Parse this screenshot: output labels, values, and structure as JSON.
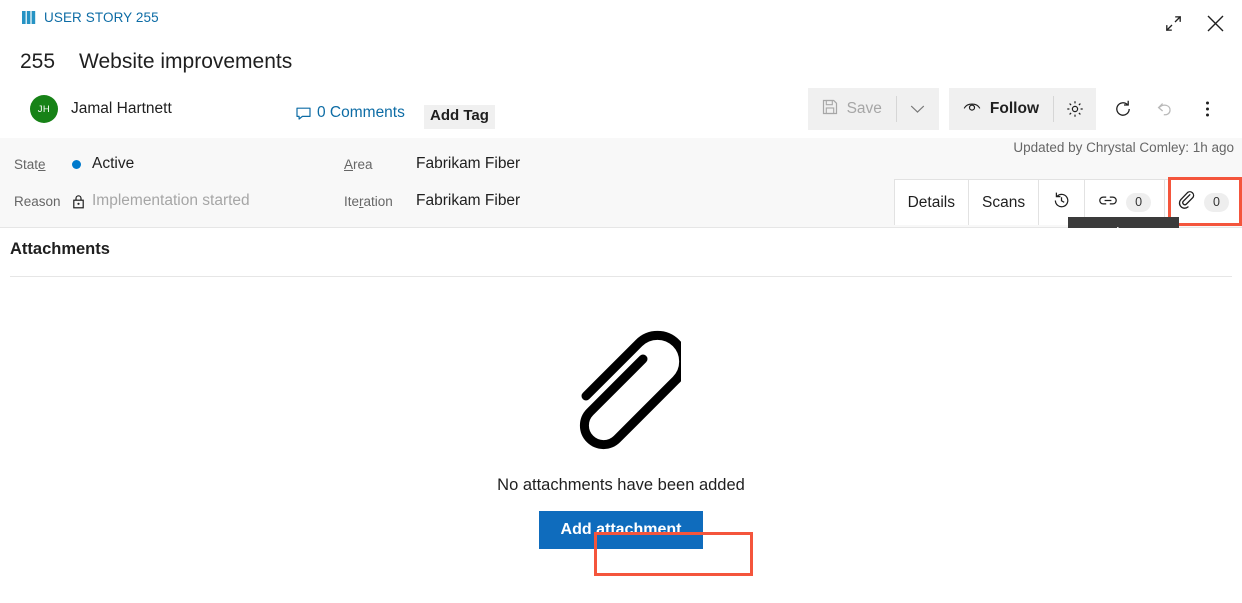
{
  "window": {
    "restore_icon": "restore-down-icon",
    "close_icon": "close-icon"
  },
  "header": {
    "work_item_type": "USER STORY 255",
    "work_item_type_icon": "user-story-icon",
    "id": "255",
    "title": "Website improvements",
    "assignee": {
      "initials": "JH",
      "name": "Jamal Hartnett",
      "avatar_color": "#178217"
    },
    "comments_label": "0 Comments",
    "comments_icon": "comment-icon",
    "add_tag_label": "Add Tag"
  },
  "toolbar": {
    "save_label": "Save",
    "save_icon": "save-disk-icon",
    "save_enabled": false,
    "save_caret_icon": "chevron-down-icon",
    "follow_label": "Follow",
    "follow_icon": "eye-icon",
    "settings_icon": "gear-icon",
    "refresh_icon": "refresh-icon",
    "undo_icon": "undo-icon",
    "more_icon": "more-vertical-icon"
  },
  "fields": {
    "state": {
      "label": "State",
      "label_accesskey": "e",
      "value": "Active",
      "dot_color": "#007acc",
      "icon": "state-dot-icon"
    },
    "reason": {
      "label": "Reason",
      "value": "Implementation started",
      "readonly": true,
      "icon": "lock-icon"
    },
    "area": {
      "label": "Area",
      "label_accesskey": "A",
      "value": "Fabrikam Fiber"
    },
    "iteration": {
      "label": "Iteration",
      "label_accesskey": "r",
      "value": "Fabrikam Fiber"
    },
    "updated_text": "Updated by Chrystal Comley: 1h ago"
  },
  "tabs": [
    {
      "label": "Details",
      "name": "tab-details",
      "icon": null,
      "count": null,
      "selected": false
    },
    {
      "label": "Scans",
      "name": "tab-scans",
      "icon": null,
      "count": null,
      "selected": false
    },
    {
      "label": "",
      "name": "tab-history",
      "icon": "history-icon",
      "count": null,
      "selected": false
    },
    {
      "label": "",
      "name": "tab-links",
      "icon": "link-icon",
      "count": "0",
      "selected": false
    },
    {
      "label": "",
      "name": "tab-attachments",
      "icon": "paperclip-icon",
      "count": "0",
      "selected": true
    }
  ],
  "tooltip": {
    "text": "Attachments"
  },
  "content": {
    "section_title": "Attachments",
    "empty_icon": "paperclip-illustration",
    "empty_message": "No attachments have been added",
    "add_button_label": "Add attachment"
  },
  "highlights": {
    "color": "#f4553c",
    "targets": [
      "attachments-tab",
      "add-attachment-button"
    ]
  },
  "colors": {
    "accent_bar": "#2693c4",
    "link": "#0d6ca5",
    "primary_button": "#0f6cbd",
    "tooltip_bg": "#3b3b3b",
    "band_bg": "#f8f8f8"
  }
}
